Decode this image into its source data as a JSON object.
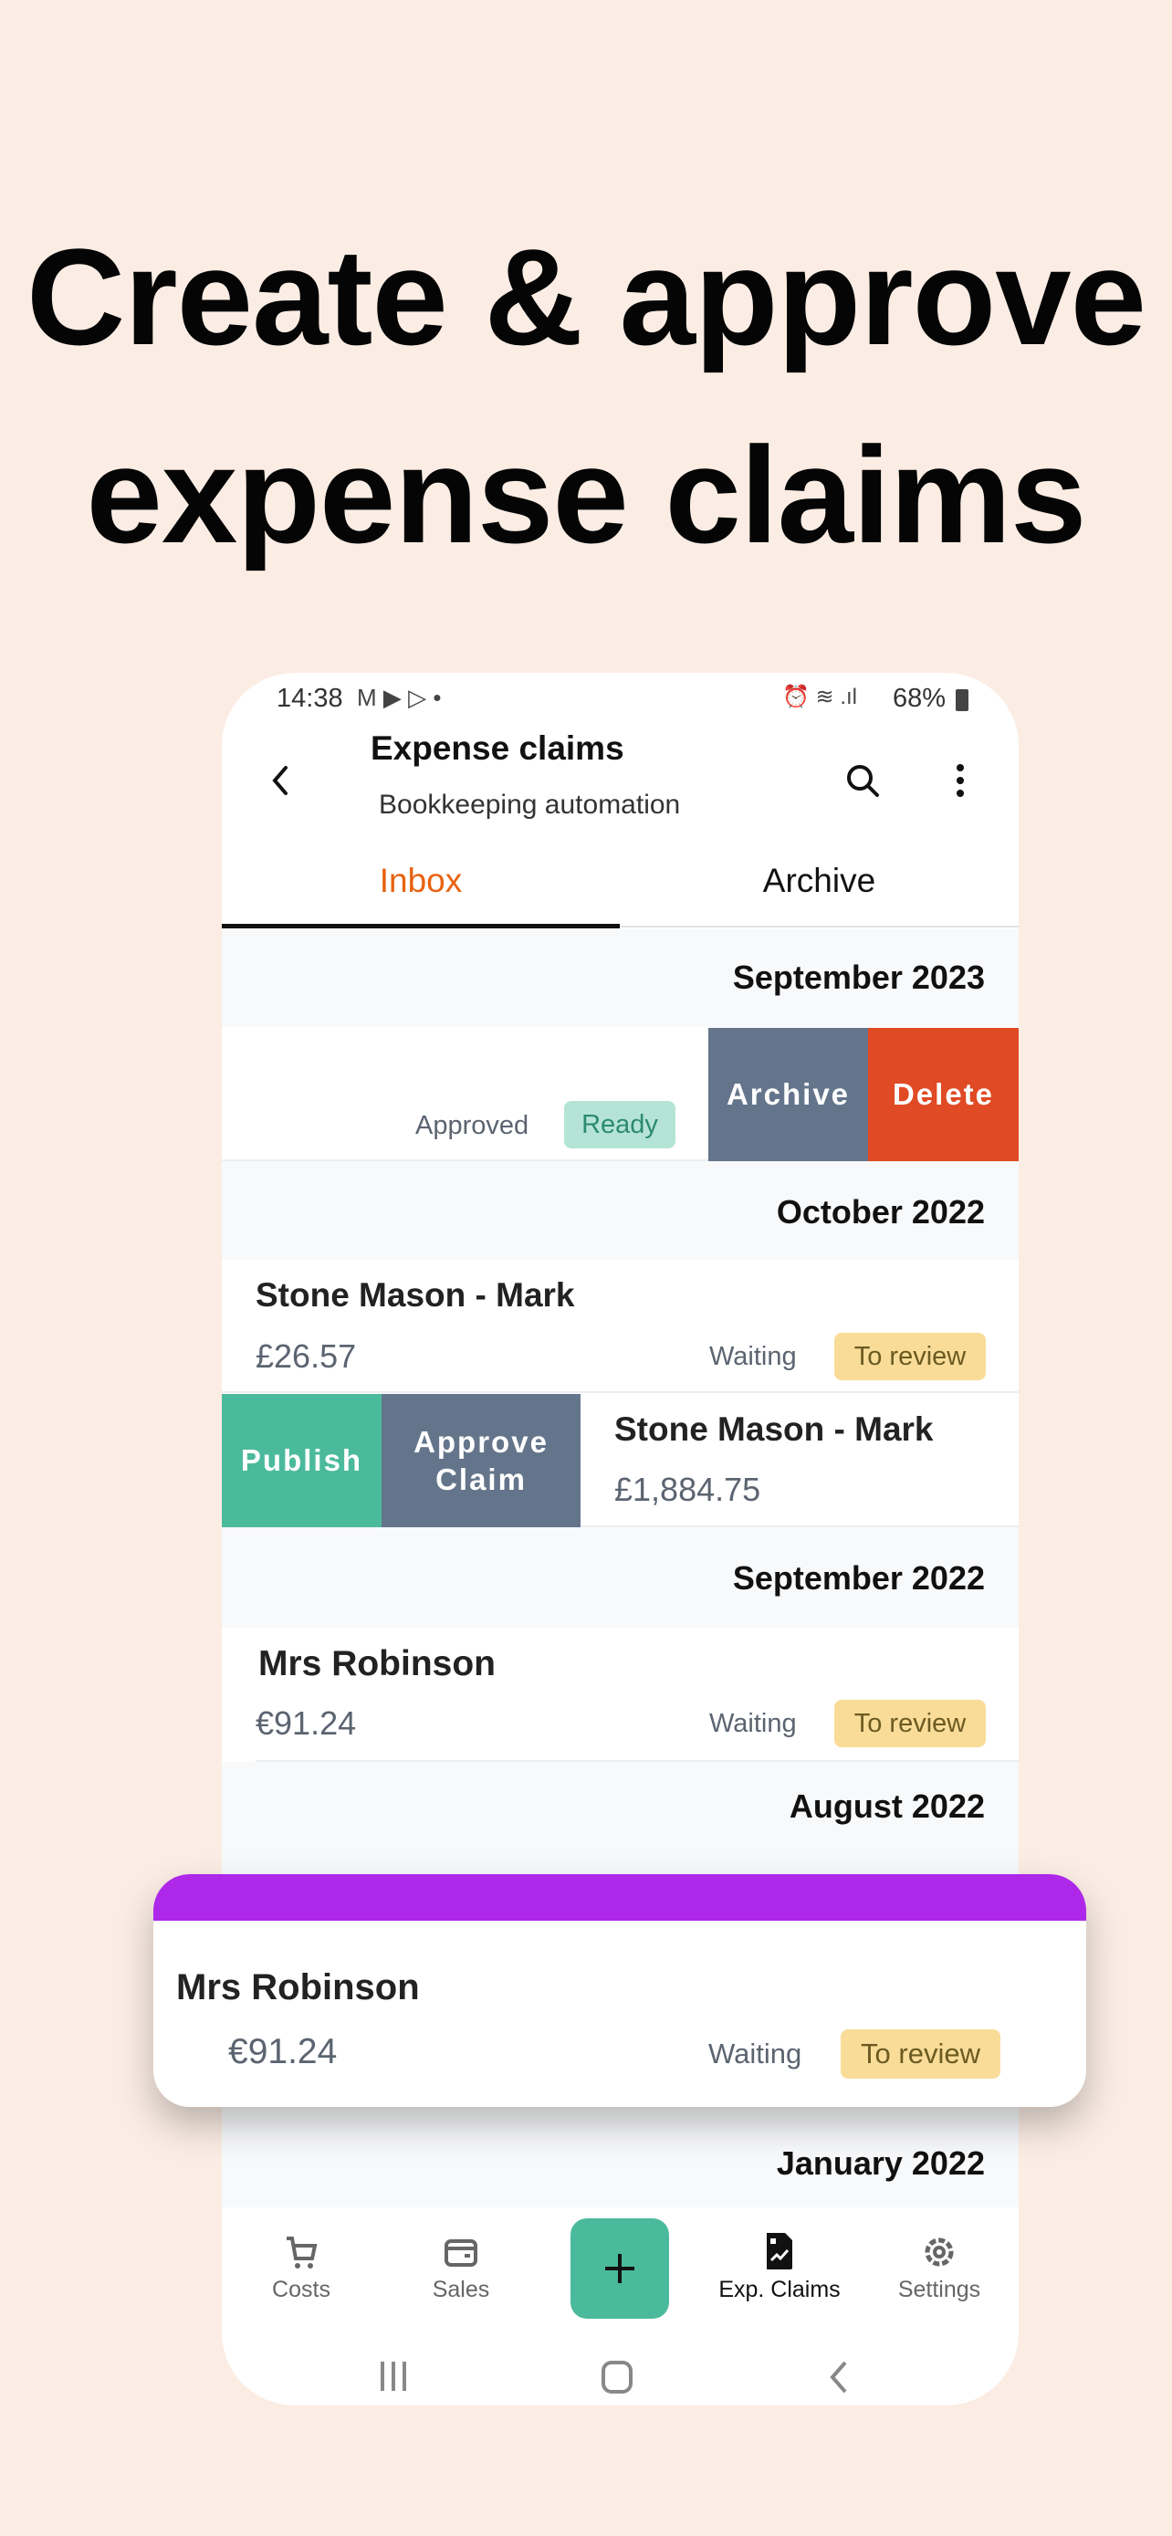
{
  "headline": {
    "line1": "Create &  approve",
    "line2": "expense claims"
  },
  "status_bar": {
    "time": "14:38",
    "battery": "68%",
    "icons": [
      "gmail-icon",
      "youtube-icon",
      "play-store-icon",
      "dot-icon",
      "alarm-icon",
      "wifi-icon",
      "signal-icon",
      "battery-icon"
    ]
  },
  "header": {
    "title": "Expense claims",
    "subtitle": "Bookkeeping automation",
    "icons": [
      "back-icon",
      "search-icon",
      "more-vert-icon"
    ]
  },
  "tabs": [
    {
      "label": "Inbox",
      "active": true
    },
    {
      "label": "Archive",
      "active": false
    }
  ],
  "colors": {
    "accent": "#e8620f",
    "teal": "#4bba9c",
    "slate": "#64758b",
    "delete": "#e04a24",
    "purple": "#ae28ea"
  },
  "list": {
    "sections": [
      {
        "month": "September 2023"
      },
      {
        "month": "October 2022"
      },
      {
        "month": "September 2022"
      },
      {
        "month": "August 2022"
      },
      {
        "month": "January 2022"
      }
    ],
    "swiped_row": {
      "status": "Approved",
      "badge": "Ready",
      "actions": [
        "Archive",
        "Delete"
      ]
    },
    "row1": {
      "name": "Stone Mason - Mark",
      "amount": "£26.57",
      "status": "Waiting",
      "badge": "To review"
    },
    "row2": {
      "name": "Stone Mason - Mark",
      "amount": "£1,884.75",
      "actions": [
        "Publish",
        "Approve Claim"
      ]
    },
    "row3": {
      "name": "Mrs Robinson",
      "amount": "€91.24",
      "status": "Waiting",
      "badge": "To review"
    }
  },
  "floating_card": {
    "name": "Mrs Robinson",
    "amount": "€91.24",
    "status": "Waiting",
    "badge": "To review"
  },
  "bottom_nav": [
    {
      "label": "Costs",
      "icon": "cart-icon"
    },
    {
      "label": "Sales",
      "icon": "wallet-icon"
    },
    {
      "label": "",
      "icon": "plus-icon"
    },
    {
      "label": "Exp. Claims",
      "icon": "expense-doc-icon",
      "active": true
    },
    {
      "label": "Settings",
      "icon": "gear-icon"
    }
  ]
}
